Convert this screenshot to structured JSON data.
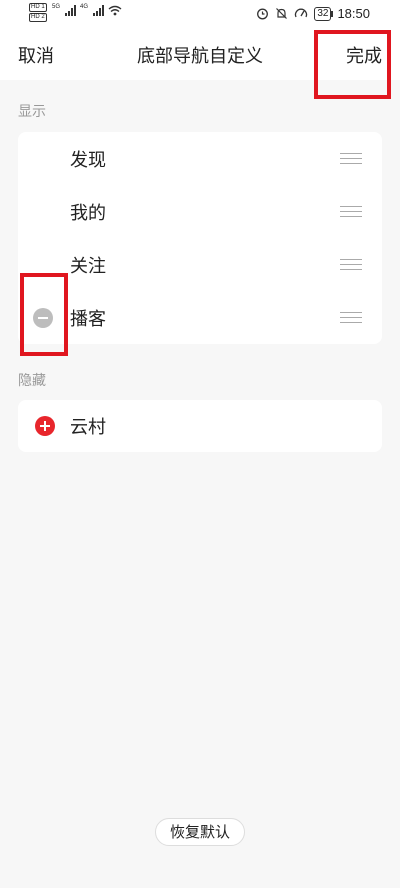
{
  "status_bar": {
    "sim1_tag": "HD 1",
    "sim2_tag": "HD 2",
    "net1": "5G",
    "net2": "4G",
    "battery": "32",
    "time": "18:50"
  },
  "header": {
    "cancel_label": "取消",
    "title": "底部导航自定义",
    "done_label": "完成"
  },
  "shown_section": {
    "label": "显示",
    "items": [
      {
        "label": "发现",
        "removable": false
      },
      {
        "label": "我的",
        "removable": false
      },
      {
        "label": "关注",
        "removable": false
      },
      {
        "label": "播客",
        "removable": true
      }
    ]
  },
  "hidden_section": {
    "label": "隐藏",
    "items": [
      {
        "label": "云村"
      }
    ]
  },
  "reset_label": "恢复默认",
  "colors": {
    "accent_red": "#e8262c",
    "highlight_box": "#e0161f",
    "minus_gray": "#bdbdbd"
  }
}
